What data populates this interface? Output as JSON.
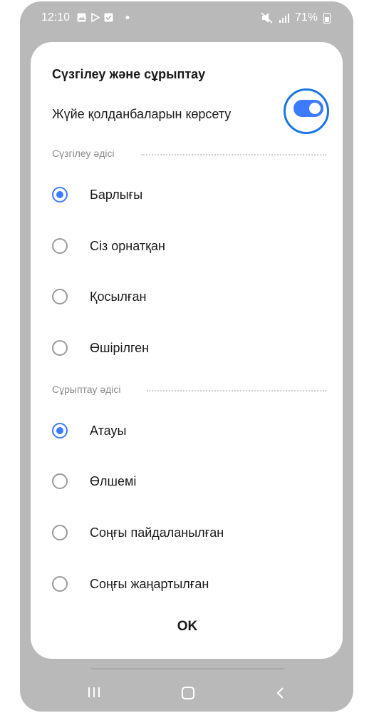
{
  "status_bar": {
    "time": "12:10",
    "battery": "71%",
    "icons_left": [
      "gallery-icon",
      "play-store-icon",
      "check-icon",
      "dot-icon"
    ],
    "icons_right": [
      "mute-icon",
      "signal-icon",
      "battery-icon"
    ]
  },
  "dialog": {
    "title": "Сүзгілеу және сұрыптау",
    "toggle": {
      "label": "Жүйе қолданбаларын көрсету",
      "state": "on",
      "color": "#3c7bff"
    },
    "filter_section": {
      "label": "Сүзгілеу әдісі",
      "options": [
        {
          "label": "Барлығы",
          "checked": true
        },
        {
          "label": "Сіз орнатқан",
          "checked": false
        },
        {
          "label": "Қосылған",
          "checked": false
        },
        {
          "label": "Өшірілген",
          "checked": false
        }
      ]
    },
    "sort_section": {
      "label": "Сұрыптау әдісі",
      "options": [
        {
          "label": "Атауы",
          "checked": true
        },
        {
          "label": "Өлшемі",
          "checked": false
        },
        {
          "label": "Соңғы пайдаланылған",
          "checked": false
        },
        {
          "label": "Соңғы жаңартылған",
          "checked": false
        }
      ]
    },
    "ok_label": "OK"
  },
  "navigation": {
    "icons": [
      "recents-icon",
      "home-icon",
      "back-icon"
    ]
  },
  "colors": {
    "accent": "#3c7bff",
    "highlight_ring": "#1976e3",
    "scrim": "#b9b9b9"
  }
}
